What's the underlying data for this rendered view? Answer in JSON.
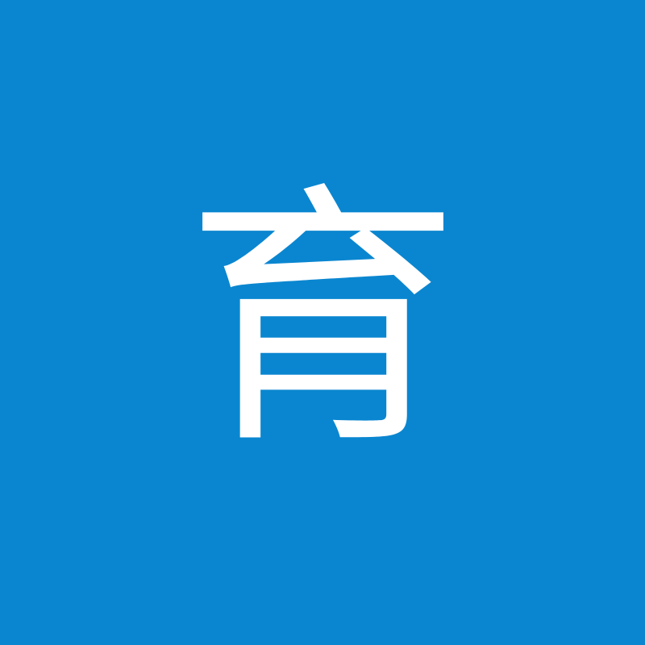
{
  "tile": {
    "character": "育",
    "background_color": "#0a86d0",
    "text_color": "#ffffff"
  }
}
